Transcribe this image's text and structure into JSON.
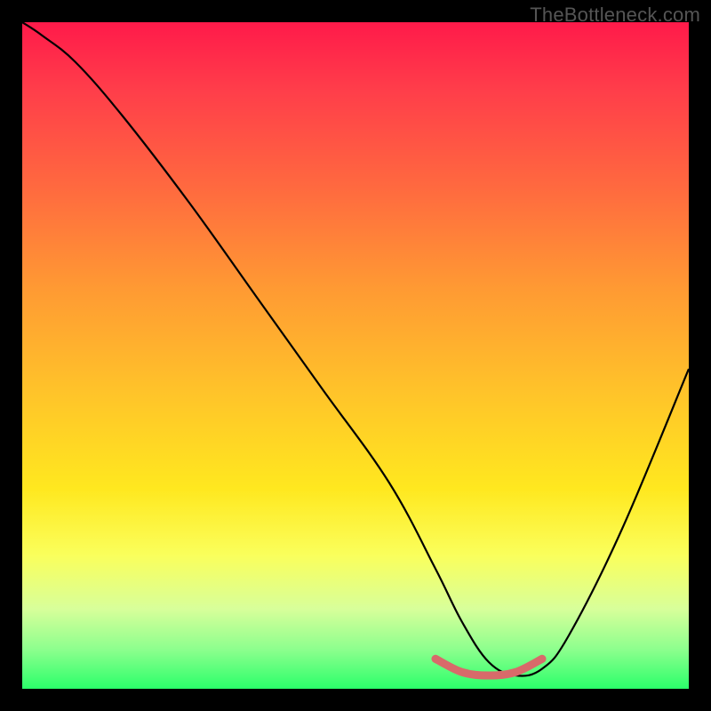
{
  "watermark": "TheBottleneck.com",
  "chart_data": {
    "type": "line",
    "title": "",
    "xlabel": "",
    "ylabel": "",
    "xlim": [
      0,
      100
    ],
    "ylim": [
      0,
      100
    ],
    "series": [
      {
        "name": "bottleneck-curve",
        "x": [
          0,
          3,
          8,
          15,
          25,
          35,
          45,
          55,
          62,
          66,
          70,
          74,
          78,
          82,
          90,
          100
        ],
        "values": [
          100,
          98,
          94,
          86,
          73,
          59,
          45,
          31,
          18,
          10,
          4,
          2,
          3,
          8,
          24,
          48
        ],
        "color": "#000000"
      },
      {
        "name": "optimal-range-marker",
        "x": [
          62,
          66,
          70,
          74,
          78
        ],
        "values": [
          4.5,
          2.5,
          2,
          2.5,
          4.5
        ],
        "color": "#d86a6a"
      }
    ],
    "gradient_stops": [
      {
        "pos": 0,
        "color": "#ff1a4a"
      },
      {
        "pos": 10,
        "color": "#ff3d4a"
      },
      {
        "pos": 25,
        "color": "#ff6a3f"
      },
      {
        "pos": 40,
        "color": "#ff9a33"
      },
      {
        "pos": 55,
        "color": "#ffc22a"
      },
      {
        "pos": 70,
        "color": "#ffe81f"
      },
      {
        "pos": 80,
        "color": "#faff5c"
      },
      {
        "pos": 88,
        "color": "#d8ff9a"
      },
      {
        "pos": 94,
        "color": "#8eff8e"
      },
      {
        "pos": 100,
        "color": "#2bff6a"
      }
    ]
  }
}
